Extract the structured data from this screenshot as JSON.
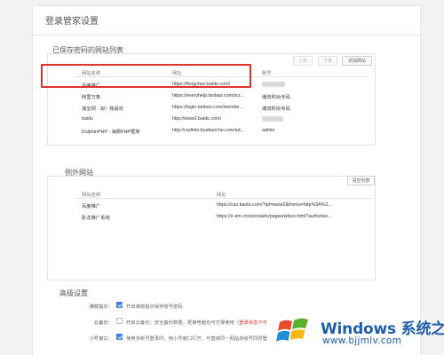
{
  "window": {
    "title": "登录管家设置"
  },
  "saved_sites": {
    "title": "已保存密码的网站列表",
    "buttons": {
      "up": "上移",
      "down": "下移",
      "add": "添加网站"
    },
    "columns": [
      "网站名称",
      "网址",
      "账号"
    ],
    "rows": [
      {
        "name": "百度推广",
        "url": "https://fengchao.baidu.com/",
        "account": ""
      },
      {
        "name": "阿里万象",
        "url": "https://everyhelp.taobao.com/scr...",
        "account": "潮流时尚专码"
      },
      {
        "name": "淘宝网 - 淘！我喜欢",
        "url": "https://login.taobao.com/membe...",
        "account": "潮流时尚专码"
      },
      {
        "name": "baidu",
        "url": "http://www2.baidu.com/",
        "account": ""
      },
      {
        "name": "DolphinPHP - 海豚PHP框架",
        "url": "http://cadmin.busbaoche.com/ad...",
        "account": "admin"
      }
    ]
  },
  "exception_sites": {
    "title": "例外网站",
    "buttons": {
      "clear": "清空列表"
    },
    "columns": [
      "网站名称",
      "网址"
    ],
    "rows": [
      {
        "name": "百度推广",
        "url": "https://cas.baidu.com/?tpl=www2&fromu=http%3A%2..."
      },
      {
        "name": "卧龙推广系统",
        "url": "https://e-sm.cn/sso/static/pages/wlsso.html?authorize..."
      }
    ]
  },
  "advanced": {
    "title": "高级设置",
    "options": [
      {
        "label": "弹窗提示：",
        "checked": true,
        "text": "开启弹窗提示保存账号密码",
        "note": ""
      },
      {
        "label": "云备份：",
        "checked": false,
        "text": "开启云备份，安全备份数据，更换电脑也可方便使用",
        "note": "（登录状态下可"
      },
      {
        "label": "小号窗口：",
        "checked": true,
        "text": "使用多帐号登录时，用小号窗口打开，可直接同一网站多帐号同时登",
        "note": ""
      }
    ]
  },
  "watermark": {
    "brand": "Windows 系统之家",
    "url": "www.bjjmlv.com"
  },
  "colors": {
    "highlight": "#e0322d",
    "checkbox": "#3d7fe6",
    "watermark": "#1f5fa8"
  }
}
